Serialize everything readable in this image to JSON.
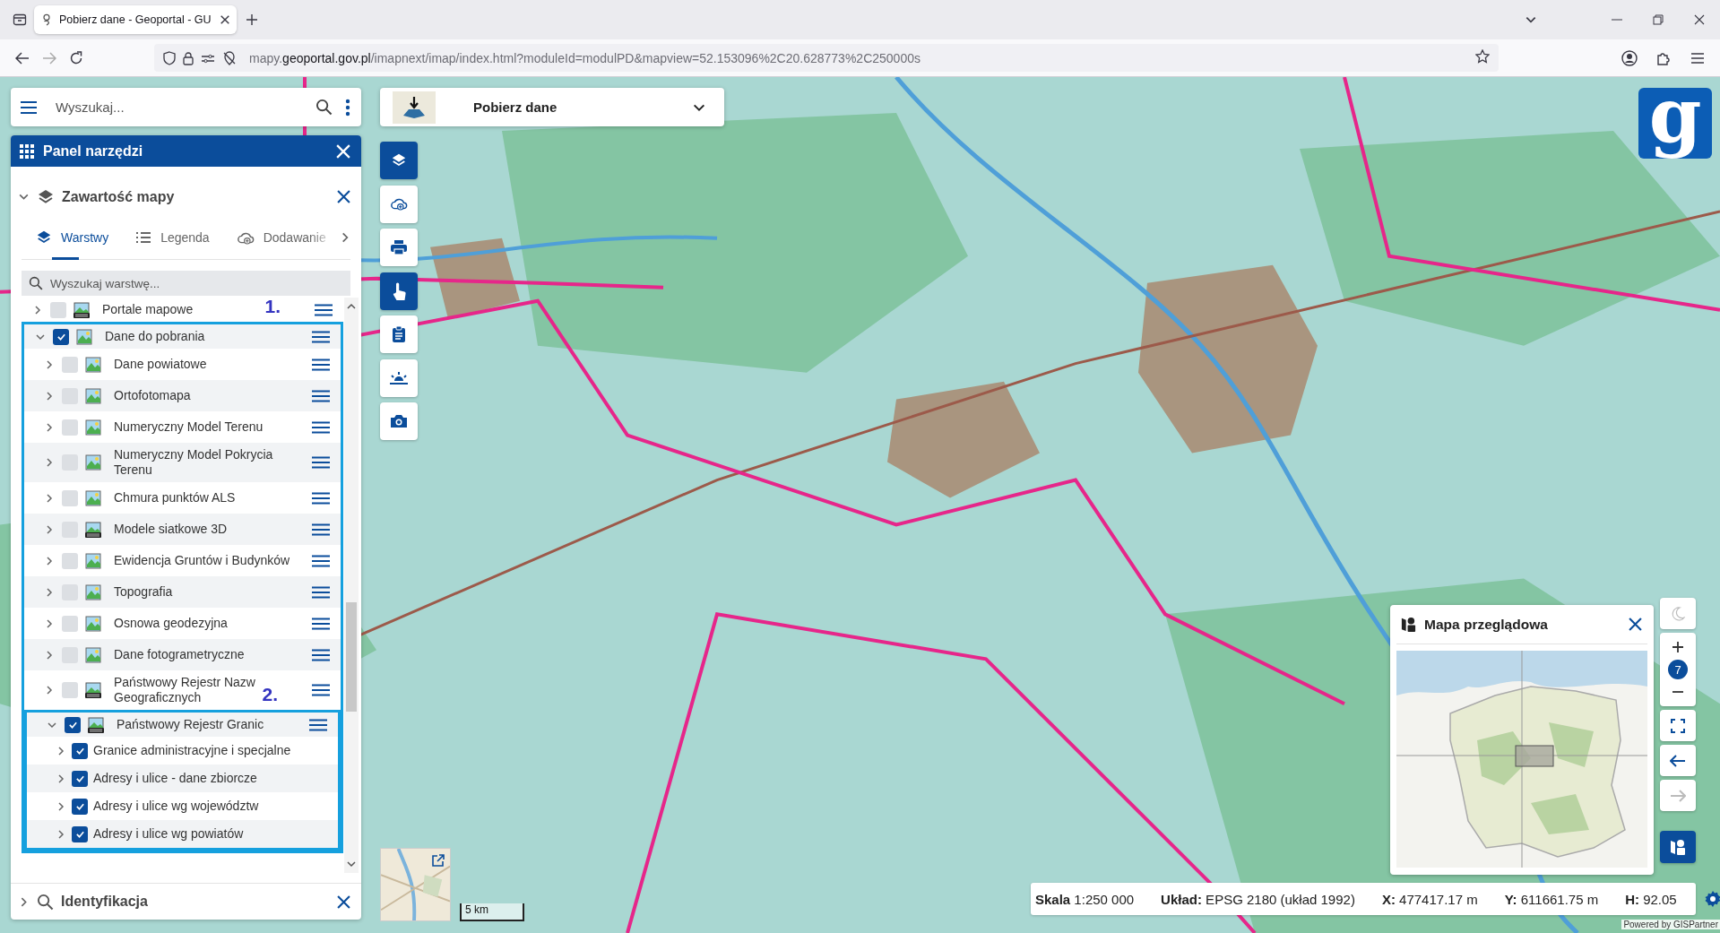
{
  "browser": {
    "tab": {
      "title": "Pobierz dane - Geoportal - GU",
      "selected": true
    },
    "url": "mapy.**geoportal.gov.pl**/imapnext/imap/index.html?moduleId=modulPD&mapview=52.153096%2C20.628773%2C250000s"
  },
  "search": {
    "placeholder": "Wyszukaj..."
  },
  "tool_panel": {
    "title": "Panel narzędzi"
  },
  "map_content": {
    "title": "Zawartość mapy",
    "expanded": true,
    "tabs": [
      {
        "label": "Warstwy",
        "selected": true
      },
      {
        "label": "Legenda",
        "selected": false
      },
      {
        "label": "Dodawanie",
        "selected": false
      }
    ],
    "layer_search": {
      "placeholder": "Wyszukaj warstwę..."
    },
    "layers": [
      {
        "name": "Portale mapowe",
        "kind": "service",
        "checked": false,
        "expanded": false
      },
      {
        "name": "Dane do pobrania",
        "checked": true,
        "expanded": true,
        "annotation": "1.",
        "children": [
          {
            "name": "Dane powiatowe",
            "checked": false,
            "expanded": false
          },
          {
            "name": "Ortofotomapa",
            "checked": false,
            "expanded": false
          },
          {
            "name": "Numeryczny Model Terenu",
            "checked": false,
            "expanded": false
          },
          {
            "name": "Numeryczny Model Pokrycia Terenu",
            "checked": false,
            "expanded": false
          },
          {
            "name": "Chmura punktów ALS",
            "checked": false,
            "expanded": false
          },
          {
            "name": "Modele siatkowe 3D",
            "kind": "service",
            "checked": false,
            "expanded": false
          },
          {
            "name": "Ewidencja Gruntów i Budynków",
            "checked": false,
            "expanded": false
          },
          {
            "name": "Topografia",
            "checked": false,
            "expanded": false
          },
          {
            "name": "Osnowa geodezyjna",
            "checked": false,
            "expanded": false
          },
          {
            "name": "Dane fotogrametryczne",
            "checked": false,
            "expanded": false
          },
          {
            "name": "Państwowy Rejestr Nazw Geograficznych",
            "kind": "service",
            "checked": false,
            "expanded": false
          },
          {
            "name": "Państwowy Rejestr Granic",
            "kind": "service",
            "checked": true,
            "expanded": true,
            "annotation": "2.",
            "children": [
              {
                "name": "Granice administracyjne i specjalne",
                "checked": true,
                "expanded": false
              },
              {
                "name": "Adresy i ulice - dane zbiorcze",
                "checked": true,
                "expanded": false
              },
              {
                "name": "Adresy i ulice wg województw",
                "checked": true,
                "expanded": false
              },
              {
                "name": "Adresy i ulice wg powiatów",
                "checked": true,
                "expanded": false
              }
            ]
          }
        ]
      }
    ]
  },
  "identification": {
    "title": "Identyfikacja",
    "expanded": false
  },
  "download_tool": {
    "label": "Pobierz dane"
  },
  "map_tools": [
    {
      "selected": true
    },
    {
      "selected": false
    },
    {
      "selected": false
    },
    {
      "selected": true
    },
    {
      "selected": false
    },
    {
      "selected": false
    },
    {
      "selected": false
    }
  ],
  "logo": {
    "letter": "g"
  },
  "overview": {
    "title": "Mapa przeglądowa"
  },
  "map_controls": {
    "zoom_level": "7",
    "back": {
      "disabled": false
    },
    "forward": {
      "disabled": true
    },
    "overview_button": {
      "selected": true
    }
  },
  "scale_bar": "5 km",
  "status_bar": [
    "**Skala** 1:250 000",
    "**Układ:** EPSG 2180 (układ 1992)",
    "**X:** 477417.17 m",
    "**Y:** 611661.75 m",
    "**H:** 92.05"
  ],
  "attribution": "Powered by GISPartner"
}
